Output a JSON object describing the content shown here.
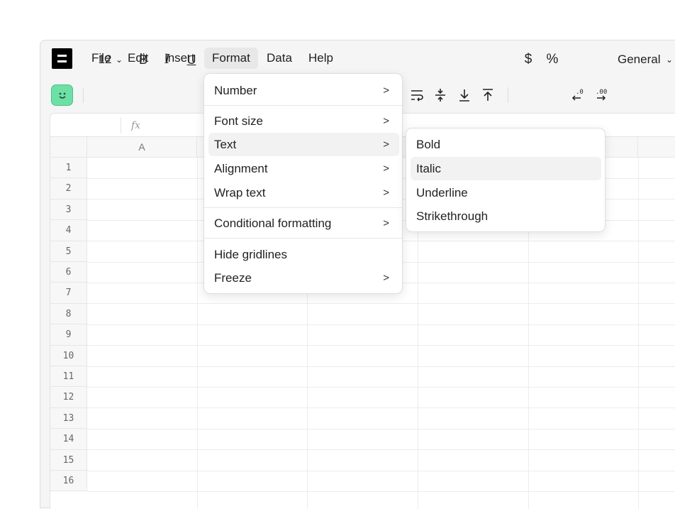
{
  "menubar": {
    "items": [
      "File",
      "Edit",
      "Insert",
      "Format",
      "Data",
      "Help"
    ],
    "active": "Format"
  },
  "toolbar": {
    "font_size": "12",
    "bold": "B",
    "italic": "I",
    "underline": "U",
    "currency": "$",
    "percent": "%",
    "number_format": "General"
  },
  "formula_bar": {
    "fx_label": "fx"
  },
  "grid": {
    "columns": [
      "A",
      "",
      "",
      "",
      "",
      ""
    ],
    "rows": [
      "1",
      "2",
      "3",
      "4",
      "5",
      "6",
      "7",
      "8",
      "9",
      "10",
      "11",
      "12",
      "13",
      "14",
      "15",
      "16"
    ]
  },
  "format_menu": {
    "items": [
      {
        "label": "Number",
        "has_submenu": true
      },
      {
        "label": "Font size",
        "has_submenu": true
      },
      {
        "label": "Text",
        "has_submenu": true
      },
      {
        "label": "Alignment",
        "has_submenu": true
      },
      {
        "label": "Wrap text",
        "has_submenu": true
      },
      {
        "label": "Conditional formatting",
        "has_submenu": true
      },
      {
        "label": "Hide gridlines",
        "has_submenu": false
      },
      {
        "label": "Freeze",
        "has_submenu": true
      }
    ],
    "highlighted": "Text"
  },
  "text_submenu": {
    "items": [
      "Bold",
      "Italic",
      "Underline",
      "Strikethrough"
    ],
    "highlighted": "Italic"
  },
  "colors": {
    "accent": "#6ee0a6",
    "accent_border": "#43c483"
  },
  "icons": {
    "logo": "app-logo-icon",
    "smiley": "smiley-icon",
    "wrap": "wrap-text-icon",
    "valign_middle": "align-middle-icon",
    "valign_bottom": "align-bottom-icon",
    "valign_top": "align-top-icon",
    "decrease_decimal": "decrease-decimal-icon",
    "increase_decimal": "increase-decimal-icon",
    "chevron": "chevron-right-icon"
  }
}
